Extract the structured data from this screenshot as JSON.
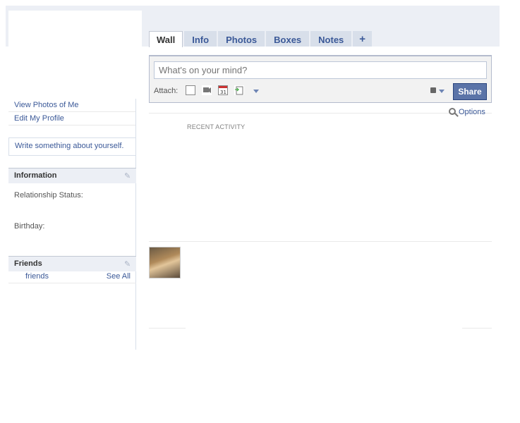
{
  "tabs": [
    {
      "label": "Wall",
      "active": true
    },
    {
      "label": "Info",
      "active": false
    },
    {
      "label": "Photos",
      "active": false
    },
    {
      "label": "Boxes",
      "active": false
    },
    {
      "label": "Notes",
      "active": false
    },
    {
      "label": "+",
      "active": false
    }
  ],
  "sidebar": {
    "view_photos": "View Photos of Me",
    "edit_profile": "Edit My Profile",
    "about_prompt": "Write something about yourself.",
    "information": {
      "title": "Information",
      "relationship_label": "Relationship Status:",
      "birthday_label": "Birthday:"
    },
    "friends": {
      "title": "Friends",
      "link": "friends",
      "see_all": "See All"
    }
  },
  "composer": {
    "placeholder": "What's on your mind?",
    "attach_label": "Attach:",
    "share_label": "Share"
  },
  "options_label": "Options",
  "recent_activity": "RECENT ACTIVITY",
  "colors": {
    "link": "#3b5998",
    "tab_bg": "#d8dfea",
    "band": "#eceff5",
    "share": "#5b74a8"
  }
}
